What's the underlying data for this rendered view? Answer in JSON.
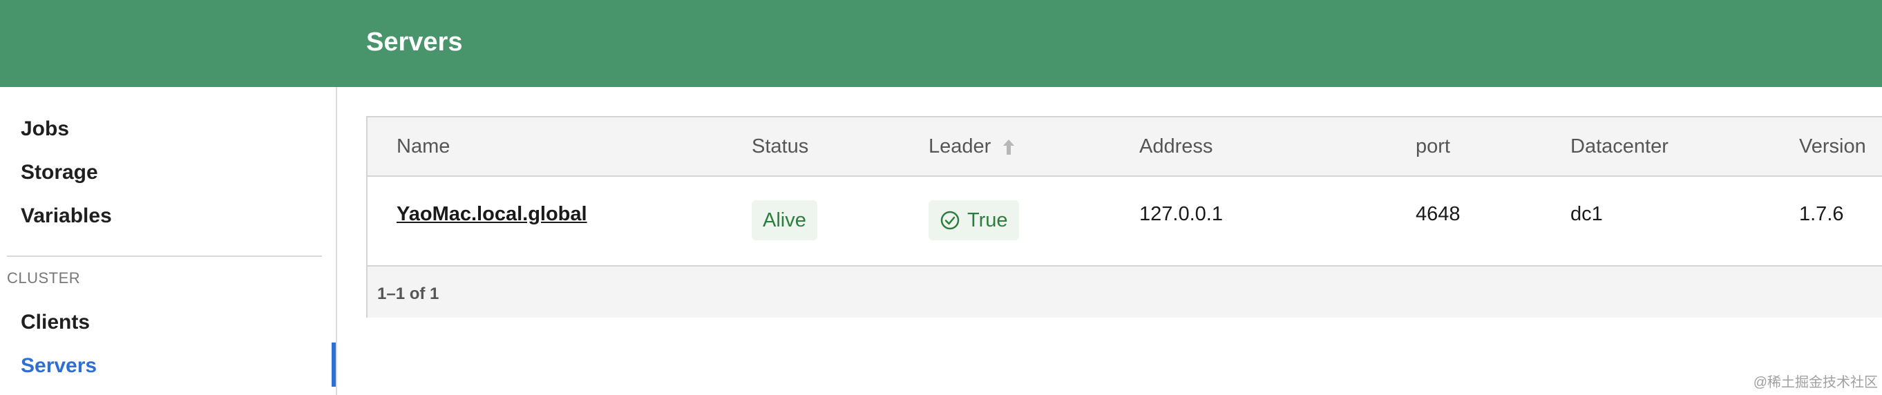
{
  "header": {
    "title": "Servers"
  },
  "sidebar": {
    "items": [
      {
        "label": "Jobs"
      },
      {
        "label": "Storage"
      },
      {
        "label": "Variables"
      }
    ],
    "cluster_section": {
      "label": "CLUSTER",
      "items": [
        {
          "label": "Clients"
        },
        {
          "label": "Servers",
          "active": true
        }
      ]
    }
  },
  "table": {
    "columns": [
      "Name",
      "Status",
      "Leader",
      "Address",
      "port",
      "Datacenter",
      "Version"
    ],
    "sort_icon": "arrow-up-icon",
    "rows": [
      {
        "name": "YaoMac.local.global",
        "status": "Alive",
        "leader": "True",
        "leader_icon": "check-circle-icon",
        "address": "127.0.0.1",
        "port": "4648",
        "datacenter": "dc1",
        "version": "1.7.6"
      }
    ],
    "pagination": "1–1 of 1"
  },
  "colors": {
    "header_bg": "#48946b",
    "active_nav": "#2e6fd6",
    "status_green": "#2d7d3f"
  },
  "watermark": "@稀土掘金技术社区"
}
